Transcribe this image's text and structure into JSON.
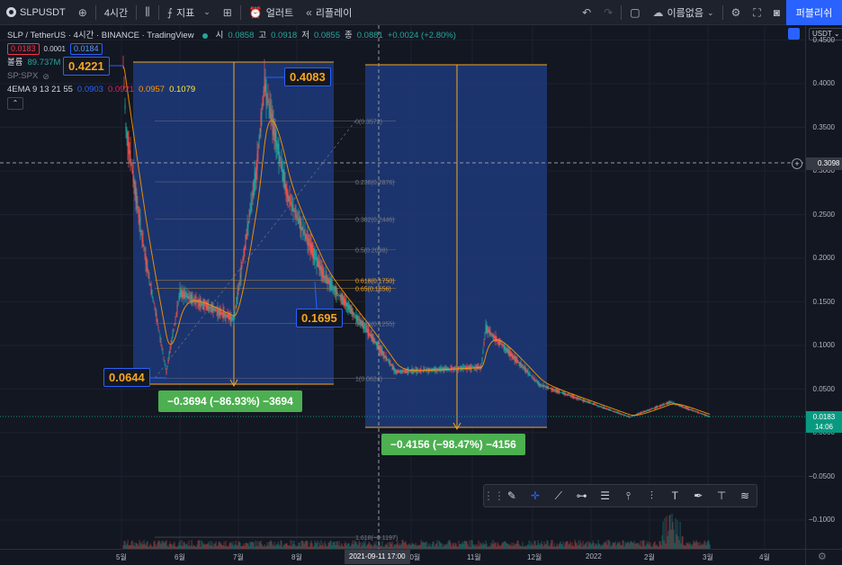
{
  "topbar": {
    "symbol": "SLPUSDT",
    "interval": "4시간",
    "indicators_label": "지표",
    "alert_label": "얼러트",
    "replay_label": "리플레이",
    "layout_name": "이름없음",
    "publish_label": "퍼블리쉬"
  },
  "legend": {
    "title": "SLP / TetherUS · 4시간 · BINANCE · TradingView",
    "open_label": "시",
    "open": "0.0858",
    "high_label": "고",
    "high": "0.0918",
    "low_label": "저",
    "low": "0.0855",
    "close_label": "종",
    "close": "0.0881",
    "change": "+0.0024 (+2.80%)",
    "bid": "0.0183",
    "spread": "0.0001",
    "ask": "0.0184",
    "volume_label": "볼륨",
    "volume": "89.737M",
    "compare_label": "SP:SPX",
    "ema_label": "4EMA 9 13 21 55",
    "ema_values": [
      "0.0903",
      "0.0921",
      "0.0957",
      "0.1079"
    ],
    "ema_colors": [
      "#2962ff",
      "#e91e63",
      "#ff9800",
      "#ffeb3b"
    ]
  },
  "currency": "USDT",
  "price_axis": {
    "ticks": [
      "0.4500",
      "0.4000",
      "0.3500",
      "0.3000",
      "0.2500",
      "0.2000",
      "0.1500",
      "0.1000",
      "0.0500",
      "0.0000",
      "−0.0500",
      "−0.1000"
    ],
    "crosshair_price": "0.3098",
    "current_price": "0.0183",
    "countdown": "14:06"
  },
  "time_axis": {
    "ticks": [
      "5월",
      "6월",
      "7월",
      "8월",
      "10월",
      "11월",
      "12월",
      "2022",
      "2월",
      "3월",
      "4월"
    ],
    "crosshair_date": "2021-09-11   17:00"
  },
  "fib": {
    "levels": [
      "0(0.3572)",
      "0.236(0.2876)",
      "0.382(0.2446)",
      "0.5(0.2098)",
      "0.618(0.1750)",
      "0.65(0.1656)",
      "0.786(0.1255)",
      "1(0.0624)",
      "1.618(−0.1197)"
    ]
  },
  "callouts": {
    "high1": "0.4221",
    "low1": "0.0644",
    "high2": "0.4083",
    "mid": "0.1695"
  },
  "ranges": {
    "range1": "−0.3694 (−86.93%) −3694",
    "range2": "−0.4156 (−98.47%) −4156"
  },
  "colors": {
    "up": "#26a69a",
    "down": "#ef5350",
    "fib": "#787b86",
    "range_fill": "#1e3a7a",
    "accent": "#2962ff"
  }
}
